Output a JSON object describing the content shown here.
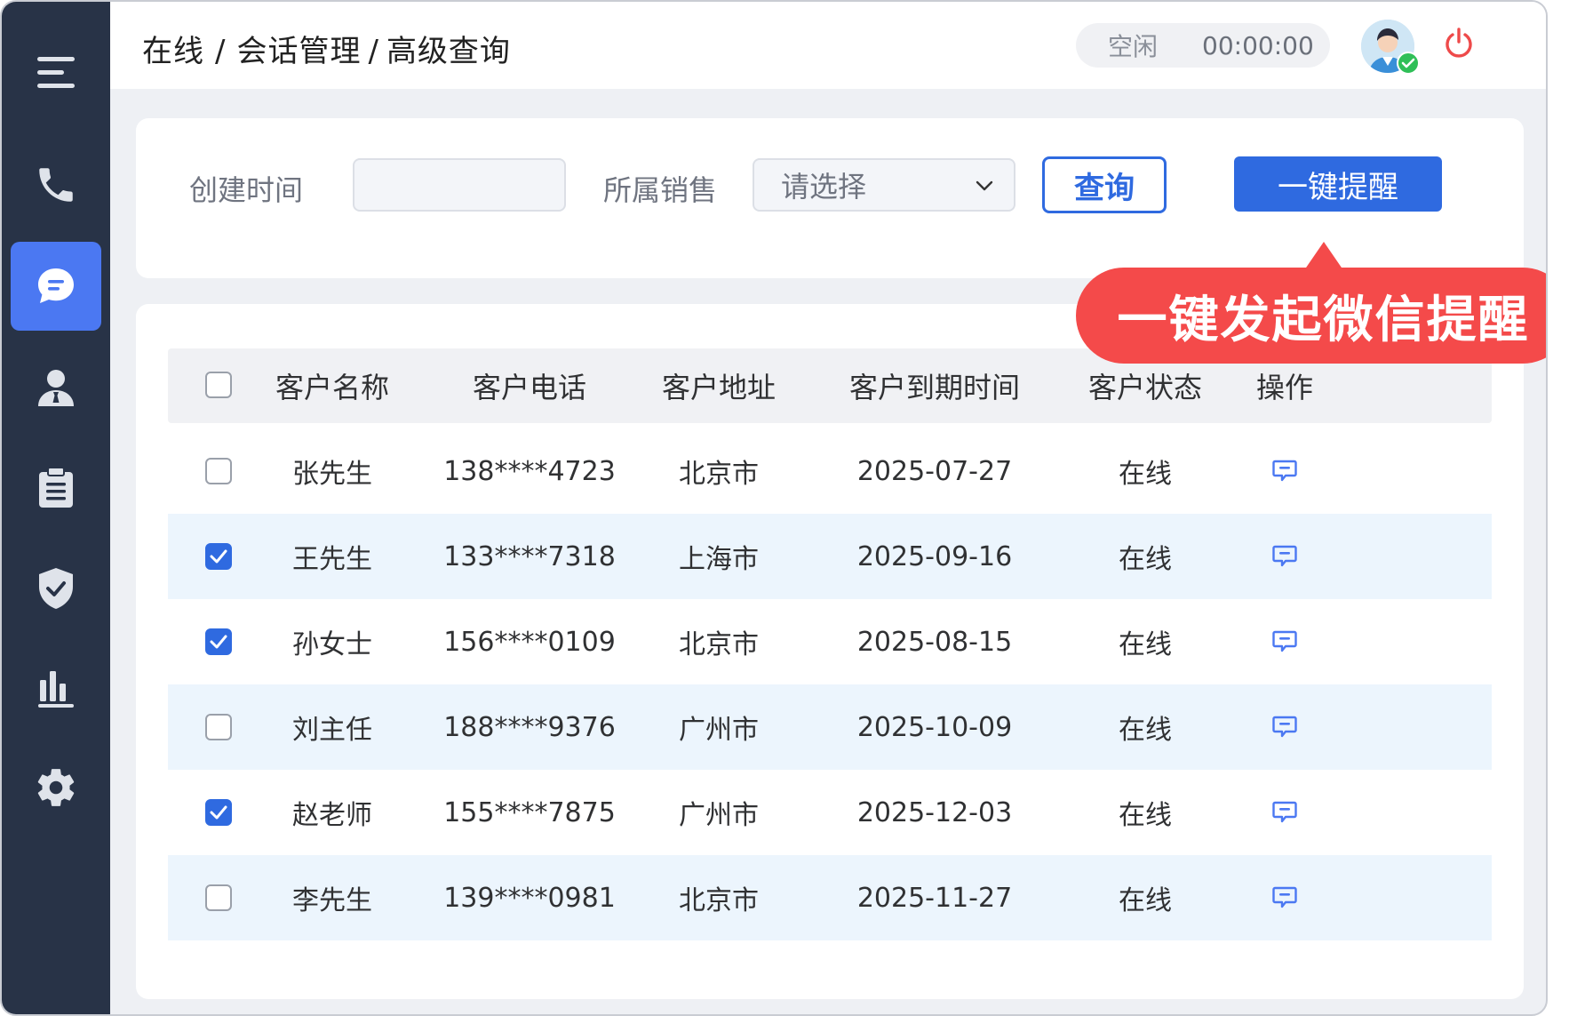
{
  "breadcrumb": [
    "在线",
    "会话管理",
    "高级查询"
  ],
  "breadcrumb_sep": "/",
  "status": {
    "state": "空闲",
    "timer": "00:00:00"
  },
  "sidebar": {
    "items": [
      "menu-icon",
      "phone-icon",
      "chat-icon",
      "user-icon",
      "clipboard-icon",
      "shield-check-icon",
      "bar-chart-icon",
      "gear-icon"
    ],
    "active_index": 2
  },
  "filters": {
    "created_label": "创建时间",
    "created_value": "",
    "sales_label": "所属销售",
    "sales_placeholder": "请选择",
    "query_label": "查询",
    "remind_label": "一键提醒"
  },
  "callout": "一键发起微信提醒",
  "table": {
    "columns": [
      "客户名称",
      "客户电话",
      "客户地址",
      "客户到期时间",
      "客户状态",
      "操作"
    ],
    "rows": [
      {
        "checked": false,
        "name": "张先生",
        "phone": "138****4723",
        "address": "北京市",
        "expiry": "2025-07-27",
        "status": "在线"
      },
      {
        "checked": true,
        "name": "王先生",
        "phone": "133****7318",
        "address": "上海市",
        "expiry": "2025-09-16",
        "status": "在线"
      },
      {
        "checked": true,
        "name": "孙女士",
        "phone": "156****0109",
        "address": "北京市",
        "expiry": "2025-08-15",
        "status": "在线"
      },
      {
        "checked": false,
        "name": "刘主任",
        "phone": "188****9376",
        "address": "广州市",
        "expiry": "2025-10-09",
        "status": "在线"
      },
      {
        "checked": true,
        "name": "赵老师",
        "phone": "155****7875",
        "address": "广州市",
        "expiry": "2025-12-03",
        "status": "在线"
      },
      {
        "checked": false,
        "name": "李先生",
        "phone": "139****0981",
        "address": "北京市",
        "expiry": "2025-11-27",
        "status": "在线"
      }
    ]
  },
  "colors": {
    "sidebar": "#283347",
    "accent": "#2f6ae0",
    "active_nav": "#4b78f2",
    "callout": "#f44a4a",
    "row_alt": "#ecf5fd"
  }
}
